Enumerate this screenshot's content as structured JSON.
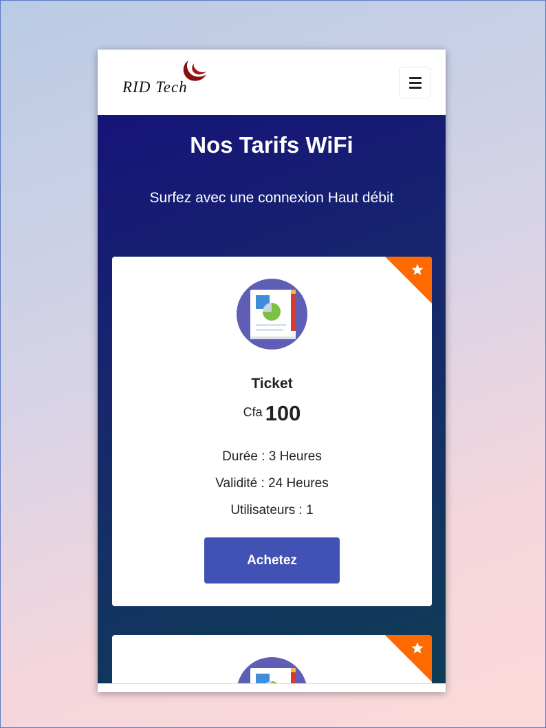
{
  "brand": {
    "logo_text": "RID  Tech",
    "mark_color": "#8b0e0e"
  },
  "navbar": {
    "menu_icon": "hamburger-menu-icon"
  },
  "hero": {
    "title": "Nos Tarifs WiFi",
    "subtitle": "Surfez avec une connexion Haut débit",
    "gradient": [
      "#151479",
      "#0e3d55"
    ]
  },
  "plans": [
    {
      "name": "Ticket",
      "currency": "Cfa",
      "price": "100",
      "details": [
        "Durée : 3 Heures",
        "Validité : 24 Heures",
        "Utilisateurs : 1"
      ],
      "button_label": "Achetez",
      "badge_icon": "star-icon",
      "badge_color": "#ff6a00",
      "icon": "document-chart-icon"
    },
    {
      "badge_icon": "star-icon",
      "badge_color": "#ff6a00",
      "icon": "document-chart-icon"
    }
  ],
  "colors": {
    "button": "#4251b4",
    "ribbon": "#ff6a00"
  }
}
